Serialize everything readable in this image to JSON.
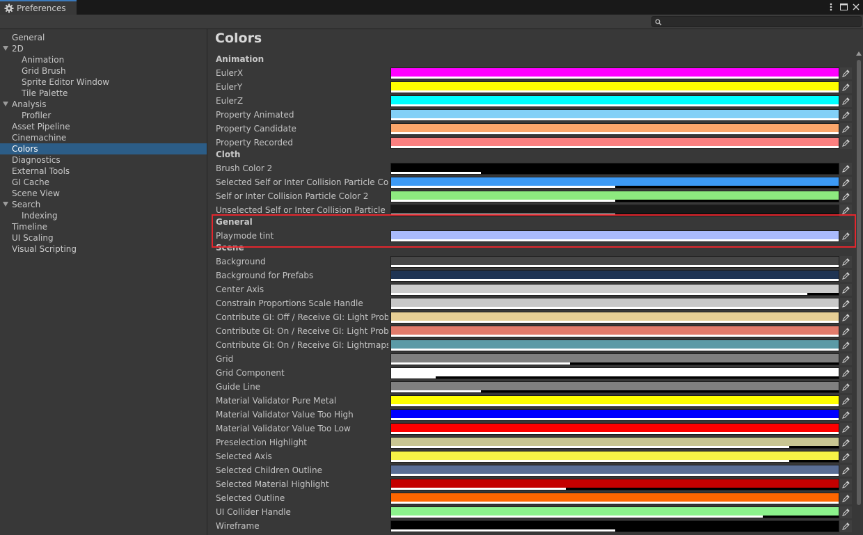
{
  "window": {
    "tab_title": "Preferences"
  },
  "search": {
    "placeholder": ""
  },
  "sidebar": {
    "items": [
      {
        "label": "General",
        "indent": 0
      },
      {
        "label": "2D",
        "indent": 0,
        "expandable": true
      },
      {
        "label": "Animation",
        "indent": 1
      },
      {
        "label": "Grid Brush",
        "indent": 1
      },
      {
        "label": "Sprite Editor Window",
        "indent": 1
      },
      {
        "label": "Tile Palette",
        "indent": 1
      },
      {
        "label": "Analysis",
        "indent": 0,
        "expandable": true
      },
      {
        "label": "Profiler",
        "indent": 1
      },
      {
        "label": "Asset Pipeline",
        "indent": 0
      },
      {
        "label": "Cinemachine",
        "indent": 0
      },
      {
        "label": "Colors",
        "indent": 0,
        "selected": true
      },
      {
        "label": "Diagnostics",
        "indent": 0
      },
      {
        "label": "External Tools",
        "indent": 0
      },
      {
        "label": "GI Cache",
        "indent": 0
      },
      {
        "label": "Scene View",
        "indent": 0
      },
      {
        "label": "Search",
        "indent": 0,
        "expandable": true
      },
      {
        "label": "Indexing",
        "indent": 1
      },
      {
        "label": "Timeline",
        "indent": 0
      },
      {
        "label": "UI Scaling",
        "indent": 0
      },
      {
        "label": "Visual Scripting",
        "indent": 0
      }
    ]
  },
  "main": {
    "title": "Colors",
    "sections": [
      {
        "title": "Animation",
        "rows": [
          {
            "label": "EulerX",
            "color": "#ff00ff",
            "alpha": 1.0
          },
          {
            "label": "EulerY",
            "color": "#ffff00",
            "alpha": 1.0
          },
          {
            "label": "EulerZ",
            "color": "#00ffff",
            "alpha": 1.0
          },
          {
            "label": "Property Animated",
            "color": "#82d0f7",
            "alpha": 1.0
          },
          {
            "label": "Property Candidate",
            "color": "#fba66b",
            "alpha": 1.0
          },
          {
            "label": "Property Recorded",
            "color": "#fb8080",
            "alpha": 1.0
          }
        ]
      },
      {
        "title": "Cloth",
        "rows": [
          {
            "label": "Brush Color 2",
            "color": "#000000",
            "alpha": 0.2
          },
          {
            "label": "Selected Self or Inter Collision Particle Color",
            "color": "#3d9af5",
            "alpha": 0.5
          },
          {
            "label": "Self or Inter Collision Particle Color 2",
            "color": "#8de97f",
            "alpha": 0.5
          },
          {
            "label": "Unselected Self or Inter Collision Particle Color",
            "color": "#191919",
            "alpha": 0.5
          }
        ]
      },
      {
        "title": "General",
        "rows": [
          {
            "label": "Playmode tint",
            "color": "#a9bafc",
            "alpha": 1.0
          }
        ]
      },
      {
        "title": "Scene",
        "rows": [
          {
            "label": "Background",
            "color": "#474747",
            "alpha": 1.0
          },
          {
            "label": "Background for Prefabs",
            "color": "#1f3453",
            "alpha": 1.0
          },
          {
            "label": "Center Axis",
            "color": "#cccccc",
            "alpha": 0.93
          },
          {
            "label": "Constrain Proportions Scale Handle",
            "color": "#c8c8c8",
            "alpha": 1.0
          },
          {
            "label": "Contribute GI: Off / Receive GI: Light Probes",
            "color": "#e7cf95",
            "alpha": 1.0
          },
          {
            "label": "Contribute GI: On / Receive GI: Light Probes",
            "color": "#e17b6b",
            "alpha": 1.0
          },
          {
            "label": "Contribute GI: On / Receive GI: Lightmaps",
            "color": "#5b9aa6",
            "alpha": 1.0
          },
          {
            "label": "Grid",
            "color": "#7f7f7f",
            "alpha": 0.4
          },
          {
            "label": "Grid Component",
            "color": "#ffffff",
            "alpha": 0.1
          },
          {
            "label": "Guide Line",
            "color": "#808080",
            "alpha": 0.2
          },
          {
            "label": "Material Validator Pure Metal",
            "color": "#ffff00",
            "alpha": 1.0
          },
          {
            "label": "Material Validator Value Too High",
            "color": "#0000ff",
            "alpha": 1.0
          },
          {
            "label": "Material Validator Value Too Low",
            "color": "#ff0000",
            "alpha": 1.0
          },
          {
            "label": "Preselection Highlight",
            "color": "#c8c592",
            "alpha": 0.89
          },
          {
            "label": "Selected Axis",
            "color": "#f7f346",
            "alpha": 0.89
          },
          {
            "label": "Selected Children Outline",
            "color": "#5a6e95",
            "alpha": 1.0
          },
          {
            "label": "Selected Material Highlight",
            "color": "#c40000",
            "alpha": 0.39
          },
          {
            "label": "Selected Outline",
            "color": "#ff6600",
            "alpha": 1.0
          },
          {
            "label": "UI Collider Handle",
            "color": "#8cf28c",
            "alpha": 0.83
          },
          {
            "label": "Wireframe",
            "color": "#000000",
            "alpha": 0.5
          }
        ]
      }
    ]
  }
}
